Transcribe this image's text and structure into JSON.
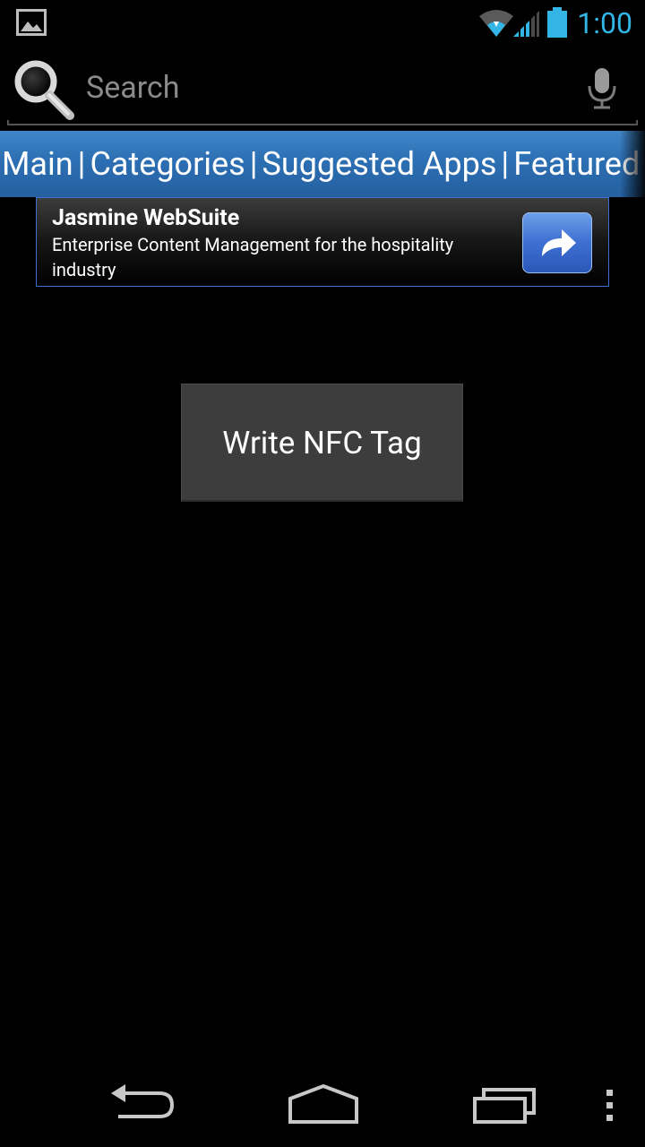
{
  "status_bar": {
    "time": "1:00",
    "icons": [
      "gallery-icon",
      "wifi-icon",
      "signal-icon",
      "battery-icon"
    ],
    "accent_color": "#33b5e5"
  },
  "search": {
    "placeholder": "Search",
    "value": "",
    "icons": [
      "search-icon",
      "mic-icon"
    ]
  },
  "nav_strip": {
    "items": [
      {
        "label": "Main"
      },
      {
        "label": "Categories"
      },
      {
        "label": "Suggested Apps"
      },
      {
        "label": "Featured"
      }
    ],
    "separator": "|",
    "background_color": "#2c6fb3"
  },
  "ad": {
    "title": "Jasmine WebSuite",
    "description": "Enterprise Content Management for the hospitality industry",
    "button_icon": "share-arrow-icon",
    "border_color": "#3f6fd0"
  },
  "main": {
    "write_button_label": "Write NFC Tag"
  },
  "system_nav": {
    "icons": [
      "back-icon",
      "home-icon",
      "recents-icon",
      "overflow-menu-icon"
    ]
  }
}
